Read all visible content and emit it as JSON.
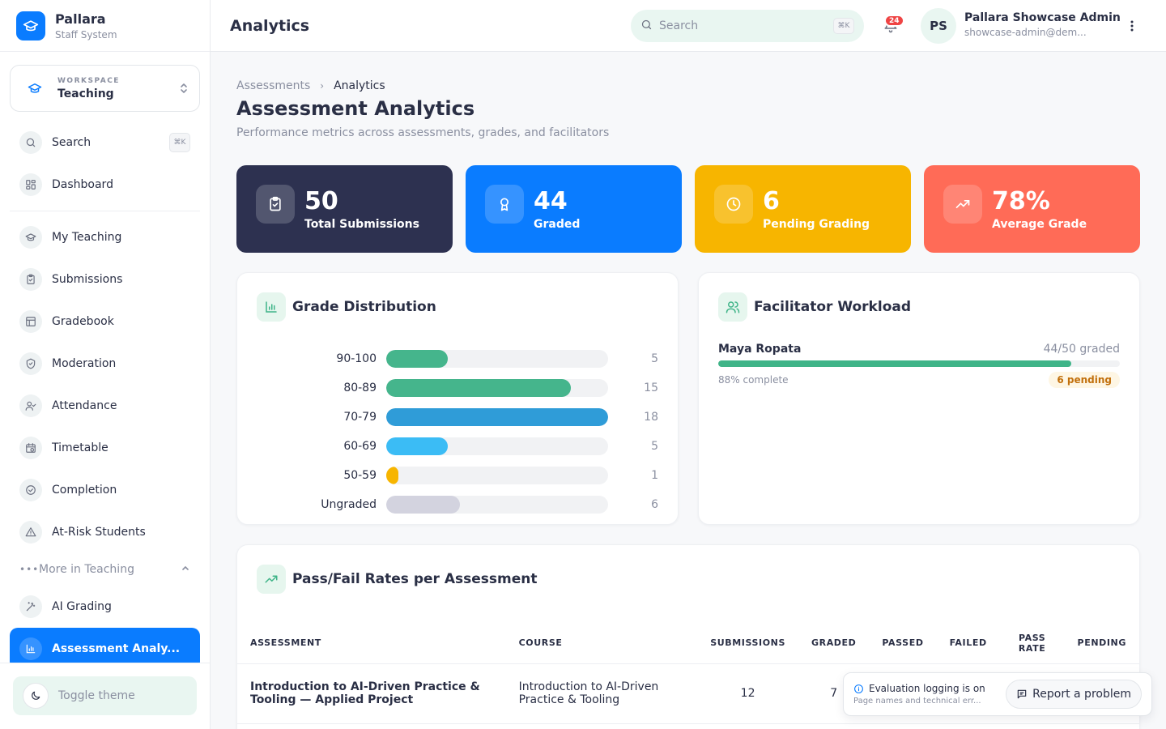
{
  "app": {
    "name": "Pallara",
    "subtitle": "Staff System"
  },
  "workspace": {
    "label": "WORKSPACE",
    "value": "Teaching"
  },
  "sidebar": {
    "search_label": "Search",
    "search_shortcut": "⌘K",
    "items": [
      {
        "label": "Dashboard",
        "icon": "grid-icon"
      },
      {
        "label": "My Teaching",
        "icon": "graduation-cap-icon"
      },
      {
        "label": "Submissions",
        "icon": "clipboard-check-icon"
      },
      {
        "label": "Gradebook",
        "icon": "table-icon"
      },
      {
        "label": "Moderation",
        "icon": "shield-check-icon"
      },
      {
        "label": "Attendance",
        "icon": "user-check-icon"
      },
      {
        "label": "Timetable",
        "icon": "calendar-clock-icon"
      },
      {
        "label": "Completion",
        "icon": "circle-check-icon"
      },
      {
        "label": "At-Risk Students",
        "icon": "warning-icon"
      }
    ],
    "more_label": "More in Teaching",
    "more_items": [
      {
        "label": "AI Grading",
        "icon": "wand-icon"
      },
      {
        "label": "Assessment Analy...",
        "icon": "bar-chart-icon",
        "active": true
      }
    ],
    "toggle_theme": "Toggle theme"
  },
  "header": {
    "title": "Analytics",
    "search_placeholder": "Search",
    "search_shortcut": "⌘K",
    "notifications": "24",
    "avatar_initials": "PS",
    "user_name": "Pallara Showcase Admin",
    "user_email": "showcase-admin@dem..."
  },
  "page": {
    "breadcrumb_parent": "Assessments",
    "breadcrumb_current": "Analytics",
    "title": "Assessment Analytics",
    "subtitle": "Performance metrics across assessments, grades, and facilitators"
  },
  "stats": [
    {
      "value": "50",
      "label": "Total Submissions",
      "color": "#2d3150"
    },
    {
      "value": "44",
      "label": "Graded",
      "color": "#0a7cff"
    },
    {
      "value": "6",
      "label": "Pending Grading",
      "color": "#f7b500"
    },
    {
      "value": "78%",
      "label": "Average Grade",
      "color": "#ff6b57"
    }
  ],
  "grade_distribution": {
    "title": "Grade Distribution",
    "rows": [
      {
        "label": "90-100",
        "count": "5",
        "value": 5,
        "color": "#45b58c"
      },
      {
        "label": "80-89",
        "count": "15",
        "value": 15,
        "color": "#45b58c"
      },
      {
        "label": "70-79",
        "count": "18",
        "value": 18,
        "color": "#2f9cd8"
      },
      {
        "label": "60-69",
        "count": "5",
        "value": 5,
        "color": "#3bbcf5"
      },
      {
        "label": "50-59",
        "count": "1",
        "value": 1,
        "color": "#f7b500"
      },
      {
        "label": "Ungraded",
        "count": "6",
        "value": 6,
        "color": "#d3d3df"
      }
    ],
    "max": 18
  },
  "workload": {
    "title": "Facilitator Workload",
    "facilitators": [
      {
        "name": "Maya Ropata",
        "stat": "44/50 graded",
        "fraction": 0.88,
        "percent_text": "88% complete",
        "pending": "6 pending"
      }
    ]
  },
  "passfail": {
    "title": "Pass/Fail Rates per Assessment",
    "columns": [
      "ASSESSMENT",
      "COURSE",
      "SUBMISSIONS",
      "GRADED",
      "PASSED",
      "FAILED",
      "PASS RATE",
      "PENDING"
    ],
    "rows": [
      {
        "assessment": "Introduction to AI-Driven Practice & Tooling — Applied Project",
        "course": "Introduction to AI-Driven Practice & Tooling",
        "submissions": "12",
        "graded": "7"
      }
    ]
  },
  "toast": {
    "title": "Evaluation logging is on",
    "subtitle": "Page names and technical err...",
    "button": "Report a problem"
  }
}
